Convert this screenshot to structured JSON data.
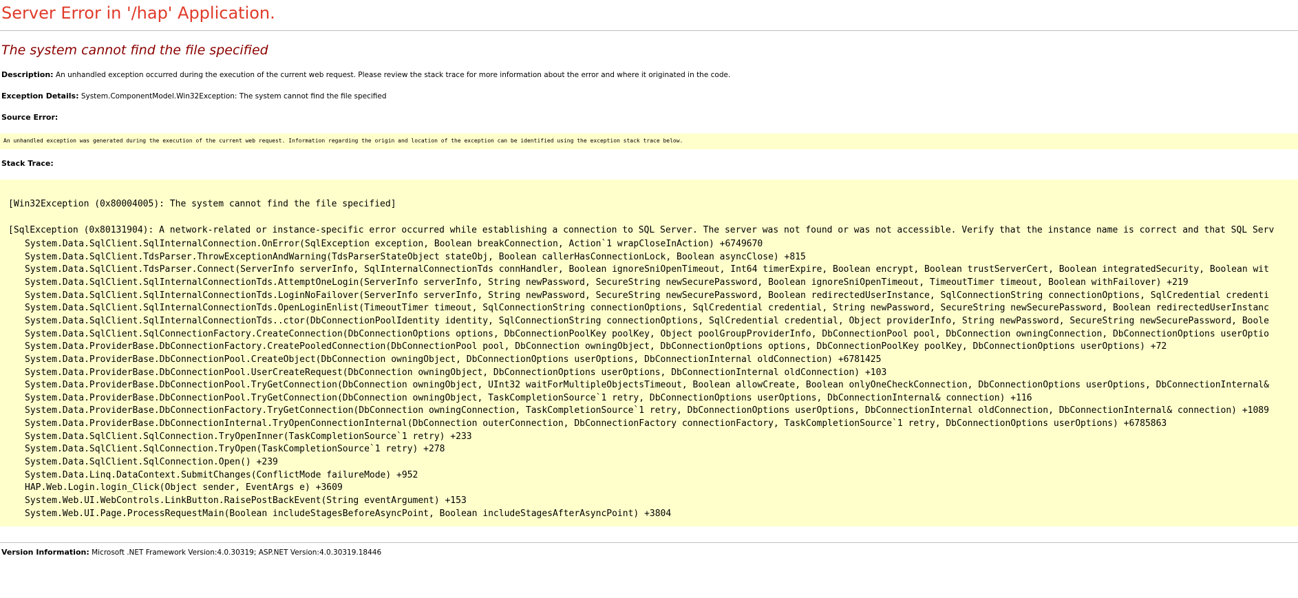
{
  "page": {
    "title": "Server Error in '/hap' Application.",
    "error_heading": "The system cannot find the file specified",
    "description_label": "Description:",
    "description_text": "An unhandled exception occurred during the execution of the current web request. Please review the stack trace for more information about the error and where it originated in the code.",
    "exception_label": "Exception Details:",
    "exception_text": "System.ComponentModel.Win32Exception: The system cannot find the file specified",
    "source_error_label": "Source Error:",
    "source_error_text": "An unhandled exception was generated during the execution of the current web request. Information regarding the origin and location of the exception can be identified using the exception stack trace below.",
    "stack_trace_label": "Stack Trace:",
    "version_label": "Version Information:",
    "version_text": "Microsoft .NET Framework Version:4.0.30319; ASP.NET Version:4.0.30319.18446"
  },
  "stack": {
    "win32": "[Win32Exception (0x80004005): The system cannot find the file specified]",
    "sql": "[SqlException (0x80131904): A network-related or instance-specific error occurred while establishing a connection to SQL Server. The server was not found or was not accessible. Verify that the instance name is correct and that SQL Serv",
    "frames": [
      "System.Data.SqlClient.SqlInternalConnection.OnError(SqlException exception, Boolean breakConnection, Action`1 wrapCloseInAction) +6749670",
      "System.Data.SqlClient.TdsParser.ThrowExceptionAndWarning(TdsParserStateObject stateObj, Boolean callerHasConnectionLock, Boolean asyncClose) +815",
      "System.Data.SqlClient.TdsParser.Connect(ServerInfo serverInfo, SqlInternalConnectionTds connHandler, Boolean ignoreSniOpenTimeout, Int64 timerExpire, Boolean encrypt, Boolean trustServerCert, Boolean integratedSecurity, Boolean wit",
      "System.Data.SqlClient.SqlInternalConnectionTds.AttemptOneLogin(ServerInfo serverInfo, String newPassword, SecureString newSecurePassword, Boolean ignoreSniOpenTimeout, TimeoutTimer timeout, Boolean withFailover) +219",
      "System.Data.SqlClient.SqlInternalConnectionTds.LoginNoFailover(ServerInfo serverInfo, String newPassword, SecureString newSecurePassword, Boolean redirectedUserInstance, SqlConnectionString connectionOptions, SqlCredential credenti",
      "System.Data.SqlClient.SqlInternalConnectionTds.OpenLoginEnlist(TimeoutTimer timeout, SqlConnectionString connectionOptions, SqlCredential credential, String newPassword, SecureString newSecurePassword, Boolean redirectedUserInstanc",
      "System.Data.SqlClient.SqlInternalConnectionTds..ctor(DbConnectionPoolIdentity identity, SqlConnectionString connectionOptions, SqlCredential credential, Object providerInfo, String newPassword, SecureString newSecurePassword, Boole",
      "System.Data.SqlClient.SqlConnectionFactory.CreateConnection(DbConnectionOptions options, DbConnectionPoolKey poolKey, Object poolGroupProviderInfo, DbConnectionPool pool, DbConnection owningConnection, DbConnectionOptions userOptio",
      "System.Data.ProviderBase.DbConnectionFactory.CreatePooledConnection(DbConnectionPool pool, DbConnection owningObject, DbConnectionOptions options, DbConnectionPoolKey poolKey, DbConnectionOptions userOptions) +72",
      "System.Data.ProviderBase.DbConnectionPool.CreateObject(DbConnection owningObject, DbConnectionOptions userOptions, DbConnectionInternal oldConnection) +6781425",
      "System.Data.ProviderBase.DbConnectionPool.UserCreateRequest(DbConnection owningObject, DbConnectionOptions userOptions, DbConnectionInternal oldConnection) +103",
      "System.Data.ProviderBase.DbConnectionPool.TryGetConnection(DbConnection owningObject, UInt32 waitForMultipleObjectsTimeout, Boolean allowCreate, Boolean onlyOneCheckConnection, DbConnectionOptions userOptions, DbConnectionInternal&",
      "System.Data.ProviderBase.DbConnectionPool.TryGetConnection(DbConnection owningObject, TaskCompletionSource`1 retry, DbConnectionOptions userOptions, DbConnectionInternal& connection) +116",
      "System.Data.ProviderBase.DbConnectionFactory.TryGetConnection(DbConnection owningConnection, TaskCompletionSource`1 retry, DbConnectionOptions userOptions, DbConnectionInternal oldConnection, DbConnectionInternal& connection) +1089",
      "System.Data.ProviderBase.DbConnectionInternal.TryOpenConnectionInternal(DbConnection outerConnection, DbConnectionFactory connectionFactory, TaskCompletionSource`1 retry, DbConnectionOptions userOptions) +6785863",
      "System.Data.SqlClient.SqlConnection.TryOpenInner(TaskCompletionSource`1 retry) +233",
      "System.Data.SqlClient.SqlConnection.TryOpen(TaskCompletionSource`1 retry) +278",
      "System.Data.SqlClient.SqlConnection.Open() +239",
      "System.Data.Linq.DataContext.SubmitChanges(ConflictMode failureMode) +952",
      "HAP.Web.Login.login_Click(Object sender, EventArgs e) +3609",
      "System.Web.UI.WebControls.LinkButton.RaisePostBackEvent(String eventArgument) +153",
      "System.Web.UI.Page.ProcessRequestMain(Boolean includeStagesBeforeAsyncPoint, Boolean includeStagesAfterAsyncPoint) +3804"
    ]
  }
}
